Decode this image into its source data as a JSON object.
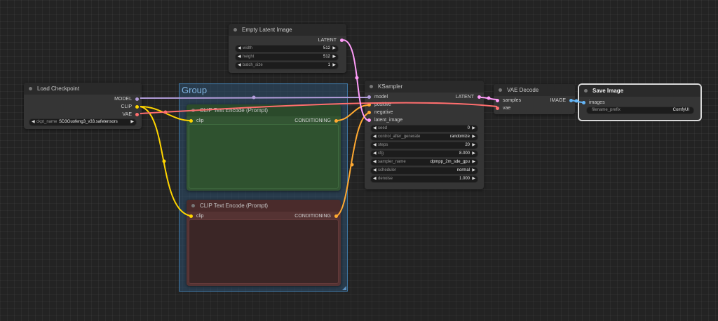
{
  "colors": {
    "background": "#232323",
    "model": "#b39ddb",
    "clip": "#ffd500",
    "vae": "#ff6e6e",
    "conditioning": "#ffa931",
    "latent": "#ff9cf9",
    "image": "#64b5f6"
  },
  "group": {
    "title": "Group"
  },
  "load_checkpoint": {
    "title": "Load Checkpoint",
    "outputs": [
      "MODEL",
      "CLIP",
      "VAE"
    ],
    "ckpt_label": "ckpt_name",
    "ckpt_value": "SD3Guofeng3_v33.safetensors"
  },
  "empty_latent": {
    "title": "Empty Latent Image",
    "output": "LATENT",
    "widgets": [
      {
        "label": "width",
        "value": "512"
      },
      {
        "label": "height",
        "value": "512"
      },
      {
        "label": "batch_size",
        "value": "1"
      }
    ]
  },
  "clip_positive": {
    "title": "CLIP Text Encode (Prompt)",
    "input": "clip",
    "output": "CONDITIONING"
  },
  "clip_negative": {
    "title": "CLIP Text Encode (Prompt)",
    "input": "clip",
    "output": "CONDITIONING"
  },
  "ksampler": {
    "title": "KSampler",
    "inputs": [
      "model",
      "positive",
      "negative",
      "latent_image"
    ],
    "output": "LATENT",
    "widgets": [
      {
        "label": "seed",
        "value": "0"
      },
      {
        "label": "control_after_generate",
        "value": "randomize"
      },
      {
        "label": "steps",
        "value": "20"
      },
      {
        "label": "cfg",
        "value": "8.000"
      },
      {
        "label": "sampler_name",
        "value": "dpmpp_2m_sde_gpu"
      },
      {
        "label": "scheduler",
        "value": "normal"
      },
      {
        "label": "denoise",
        "value": "1.000"
      }
    ]
  },
  "vae_decode": {
    "title": "VAE Decode",
    "inputs": [
      "samples",
      "vae"
    ],
    "output": "IMAGE"
  },
  "save_image": {
    "title": "Save Image",
    "input": "images",
    "prefix_label": "filename_prefix",
    "prefix_value": "ComfyUI"
  },
  "icons": {
    "left_arrow": "◀",
    "right_arrow": "▶"
  }
}
